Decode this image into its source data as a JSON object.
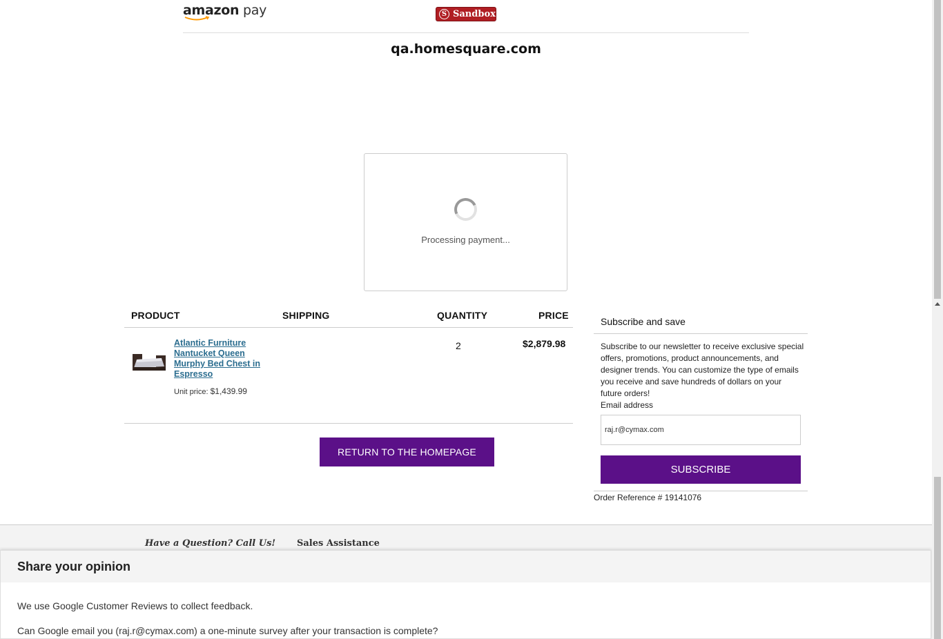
{
  "header": {
    "logo_brand": "amazon",
    "logo_suffix": "pay",
    "sandbox_badge": "Sandbox",
    "sandbox_letter": "S",
    "merchant_domain": "qa.homesquare.com"
  },
  "processing": {
    "message": "Processing payment..."
  },
  "order_table": {
    "columns": [
      "PRODUCT",
      "SHIPPING",
      "QUANTITY",
      "PRICE"
    ],
    "items": [
      {
        "name": "Atlantic Furniture Nantucket Queen Murphy Bed Chest in Espresso",
        "unit_price_label": "Unit price:",
        "unit_price": "$1,439.99",
        "shipping": "",
        "quantity": "2",
        "price": "$2,879.98"
      }
    ],
    "return_button": "RETURN TO THE HOMEPAGE"
  },
  "subscribe": {
    "title": "Subscribe and save",
    "description": "Subscribe to our newsletter to receive exclusive special offers, promotions, product announcements, and designer trends. You can customize the type of emails you receive and save hundreds of dollars on your future orders!",
    "email_label": "Email address",
    "email_value": "raj.r@cymax.com",
    "button_label": "SUBSCRIBE",
    "order_reference": "Order Reference # 19141076"
  },
  "footer": {
    "question": "Have a Question? Call Us!",
    "sales": "Sales Assistance"
  },
  "popup": {
    "title": "Share your opinion",
    "line1": "We use Google Customer Reviews to collect feedback.",
    "line2": "Can Google email you (raj.r@cymax.com) a one-minute survey after your transaction is complete?"
  },
  "colors": {
    "accent_purple": "#5b1088",
    "sandbox_red": "#b01e23",
    "link_teal": "#2b6d8f"
  }
}
